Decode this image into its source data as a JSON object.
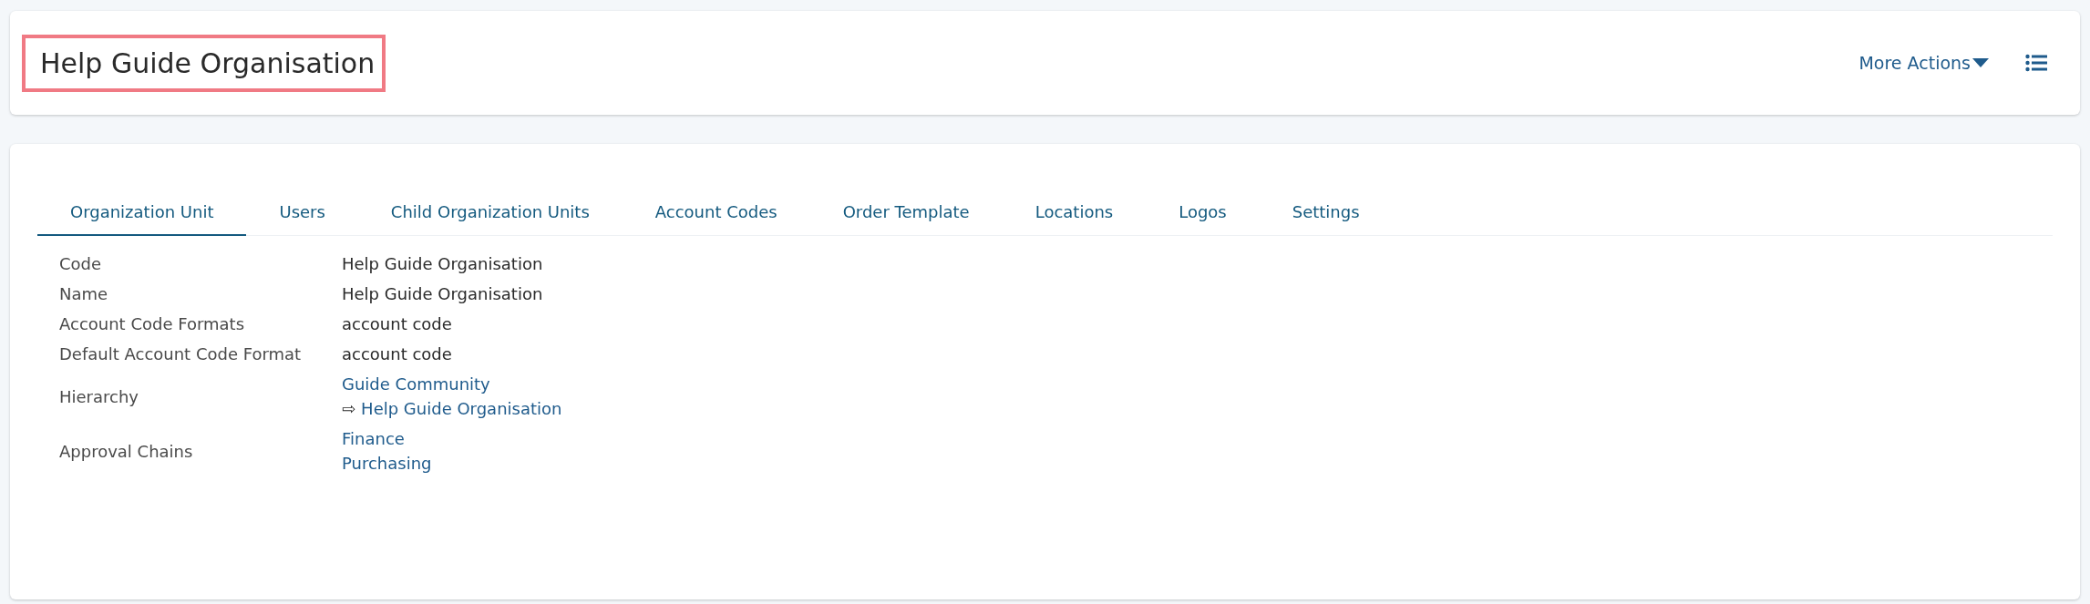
{
  "header": {
    "title": "Help Guide Organisation",
    "highlighted": true,
    "actions_label": "More Actions"
  },
  "tabs": [
    {
      "label": "Organization Unit",
      "selected": true
    },
    {
      "label": "Users",
      "selected": false
    },
    {
      "label": "Child Organization Units",
      "selected": false
    },
    {
      "label": "Account Codes",
      "selected": false
    },
    {
      "label": "Order Template",
      "selected": false
    },
    {
      "label": "Locations",
      "selected": false
    },
    {
      "label": "Logos",
      "selected": false
    },
    {
      "label": "Settings",
      "selected": false
    }
  ],
  "details": [
    {
      "label": "Code",
      "values": [
        {
          "kind": "text",
          "text": "Help Guide Organisation"
        }
      ]
    },
    {
      "label": "Name",
      "values": [
        {
          "kind": "text",
          "text": "Help Guide Organisation"
        }
      ]
    },
    {
      "label": "Account Code Formats",
      "values": [
        {
          "kind": "text",
          "text": "account code"
        }
      ]
    },
    {
      "label": "Default Account Code Format",
      "values": [
        {
          "kind": "text",
          "text": "account code"
        }
      ]
    },
    {
      "label": "Hierarchy",
      "values": [
        {
          "kind": "link",
          "text": "Guide Community"
        },
        {
          "kind": "link",
          "prefix": "⇨",
          "text": "Help Guide Organisation"
        }
      ]
    },
    {
      "label": "Approval Chains",
      "values": [
        {
          "kind": "link",
          "text": "Finance"
        },
        {
          "kind": "link",
          "text": "Purchasing"
        }
      ]
    }
  ]
}
